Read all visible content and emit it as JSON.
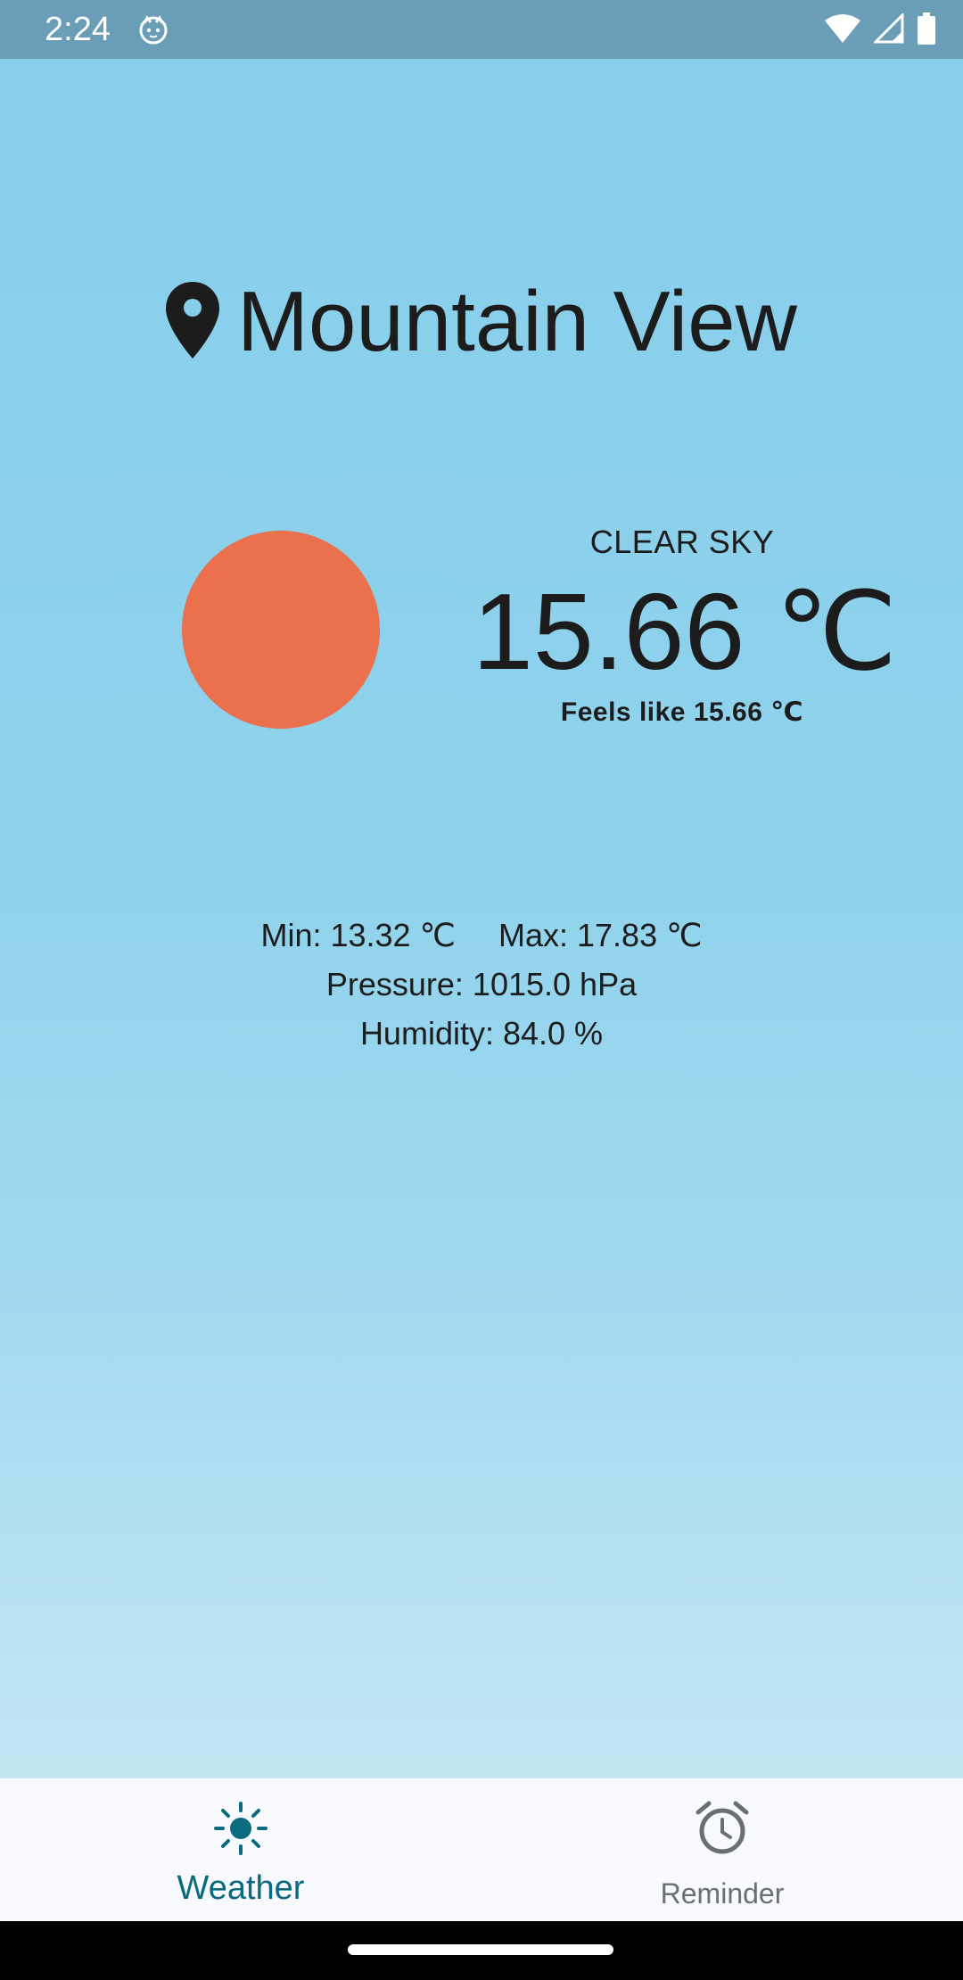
{
  "status_bar": {
    "time": "2:24",
    "icons": [
      "cat-icon",
      "wifi-icon",
      "cell-signal-icon",
      "battery-icon"
    ]
  },
  "location": {
    "icon": "location-pin-icon",
    "city": "Mountain View"
  },
  "weather": {
    "icon": "sun-icon",
    "condition": "CLEAR SKY",
    "temperature": "15.66 ℃",
    "feels_like": "Feels like 15.66 ℃",
    "min": "Min: 13.32 ℃",
    "max": "Max: 17.83 ℃",
    "pressure": "Pressure: 1015.0 hPa",
    "humidity": "Humidity: 84.0 %"
  },
  "bottom_nav": {
    "items": [
      {
        "label": "Weather",
        "icon": "sun-icon",
        "active": true
      },
      {
        "label": "Reminder",
        "icon": "alarm-clock-icon",
        "active": false
      }
    ]
  },
  "colors": {
    "status_bar": "#6a9db6",
    "sky": "#87ceeb",
    "sun": "#ea704e",
    "active_nav": "#0a6a80",
    "inactive_nav": "#6b6f73"
  }
}
